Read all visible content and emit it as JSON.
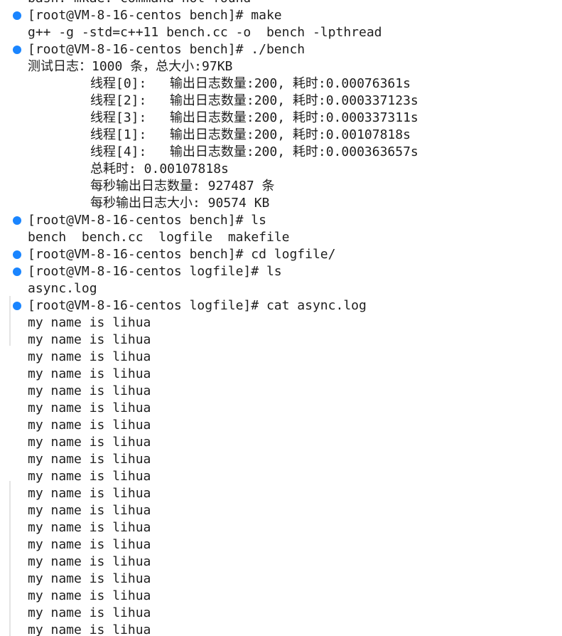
{
  "terminal": {
    "colors": {
      "background": "#ffffff",
      "text": "#1e1e1e",
      "prompt_dot": "#1a85ff",
      "executable": "#0f7b0f",
      "directory": "#0451a5",
      "gutter": "#e4e4e4"
    },
    "lines": [
      {
        "kind": "prompt",
        "text": "bash: mkae: command not found"
      },
      {
        "kind": "prompt",
        "text": "[root@VM-8-16-centos bench]# make"
      },
      {
        "kind": "output",
        "text": "g++ -g -std=c++11 bench.cc -o  bench -lpthread"
      },
      {
        "kind": "prompt",
        "text": "[root@VM-8-16-centos bench]# ./bench"
      },
      {
        "kind": "output",
        "text": "测试日志：1000 条，总大小:97KB"
      },
      {
        "kind": "output",
        "indent": true,
        "text": "线程[0]:   输出日志数量:200, 耗时:0.00076361s"
      },
      {
        "kind": "output",
        "indent": true,
        "text": "线程[2]:   输出日志数量:200, 耗时:0.000337123s"
      },
      {
        "kind": "output",
        "indent": true,
        "text": "线程[3]:   输出日志数量:200, 耗时:0.000337311s"
      },
      {
        "kind": "output",
        "indent": true,
        "text": "线程[1]:   输出日志数量:200, 耗时:0.00107818s"
      },
      {
        "kind": "output",
        "indent": true,
        "text": "线程[4]:   输出日志数量:200, 耗时:0.000363657s"
      },
      {
        "kind": "output",
        "indent": true,
        "text": "总耗时: 0.00107818s"
      },
      {
        "kind": "output",
        "indent": true,
        "text": "每秒输出日志数量: 927487 条"
      },
      {
        "kind": "output",
        "indent": true,
        "text": "每秒输出日志大小: 90574 KB"
      },
      {
        "kind": "prompt",
        "text": "[root@VM-8-16-centos bench]# ls"
      },
      {
        "kind": "listing",
        "items": [
          {
            "text": "bench",
            "type": "executable"
          },
          {
            "text": "bench.cc",
            "type": "plain"
          },
          {
            "text": "logfile",
            "type": "directory"
          },
          {
            "text": "makefile",
            "type": "plain"
          }
        ]
      },
      {
        "kind": "prompt",
        "text": "[root@VM-8-16-centos bench]# cd logfile/"
      },
      {
        "kind": "prompt",
        "text": "[root@VM-8-16-centos logfile]# ls"
      },
      {
        "kind": "output",
        "text": "async.log"
      },
      {
        "kind": "prompt",
        "text": "[root@VM-8-16-centos logfile]# cat async.log"
      },
      {
        "kind": "output",
        "text": "my name is lihua"
      },
      {
        "kind": "output",
        "text": "my name is lihua"
      },
      {
        "kind": "output",
        "text": "my name is lihua"
      },
      {
        "kind": "output",
        "text": "my name is lihua"
      },
      {
        "kind": "output",
        "text": "my name is lihua"
      },
      {
        "kind": "output",
        "text": "my name is lihua"
      },
      {
        "kind": "output",
        "text": "my name is lihua"
      },
      {
        "kind": "output",
        "text": "my name is lihua"
      },
      {
        "kind": "output",
        "text": "my name is lihua"
      },
      {
        "kind": "output",
        "text": "my name is lihua"
      },
      {
        "kind": "output",
        "text": "my name is lihua"
      },
      {
        "kind": "output",
        "text": "my name is lihua"
      },
      {
        "kind": "output",
        "text": "my name is lihua"
      },
      {
        "kind": "output",
        "text": "my name is lihua"
      },
      {
        "kind": "output",
        "text": "my name is lihua"
      },
      {
        "kind": "output",
        "text": "my name is lihua"
      },
      {
        "kind": "output",
        "text": "my name is lihua"
      },
      {
        "kind": "output",
        "text": "my name is lihua"
      },
      {
        "kind": "output",
        "text": "my name is lihua"
      }
    ]
  }
}
